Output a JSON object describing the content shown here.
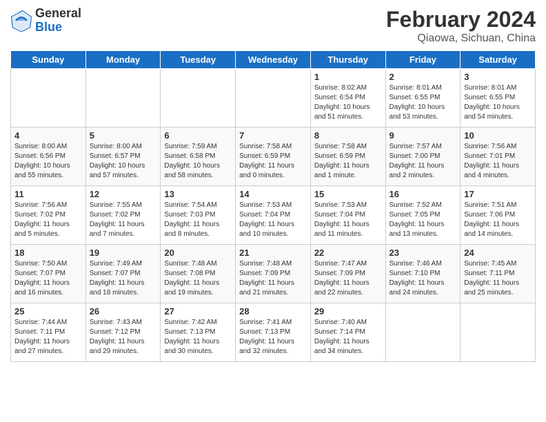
{
  "header": {
    "logo_line1": "General",
    "logo_line2": "Blue",
    "main_title": "February 2024",
    "subtitle": "Qiaowa, Sichuan, China"
  },
  "days_of_week": [
    "Sunday",
    "Monday",
    "Tuesday",
    "Wednesday",
    "Thursday",
    "Friday",
    "Saturday"
  ],
  "weeks": [
    [
      {
        "num": "",
        "content": ""
      },
      {
        "num": "",
        "content": ""
      },
      {
        "num": "",
        "content": ""
      },
      {
        "num": "",
        "content": ""
      },
      {
        "num": "1",
        "content": "Sunrise: 8:02 AM\nSunset: 6:54 PM\nDaylight: 10 hours\nand 51 minutes."
      },
      {
        "num": "2",
        "content": "Sunrise: 8:01 AM\nSunset: 6:55 PM\nDaylight: 10 hours\nand 53 minutes."
      },
      {
        "num": "3",
        "content": "Sunrise: 8:01 AM\nSunset: 6:55 PM\nDaylight: 10 hours\nand 54 minutes."
      }
    ],
    [
      {
        "num": "4",
        "content": "Sunrise: 8:00 AM\nSunset: 6:56 PM\nDaylight: 10 hours\nand 55 minutes."
      },
      {
        "num": "5",
        "content": "Sunrise: 8:00 AM\nSunset: 6:57 PM\nDaylight: 10 hours\nand 57 minutes."
      },
      {
        "num": "6",
        "content": "Sunrise: 7:59 AM\nSunset: 6:58 PM\nDaylight: 10 hours\nand 58 minutes."
      },
      {
        "num": "7",
        "content": "Sunrise: 7:58 AM\nSunset: 6:59 PM\nDaylight: 11 hours\nand 0 minutes."
      },
      {
        "num": "8",
        "content": "Sunrise: 7:58 AM\nSunset: 6:59 PM\nDaylight: 11 hours\nand 1 minute."
      },
      {
        "num": "9",
        "content": "Sunrise: 7:57 AM\nSunset: 7:00 PM\nDaylight: 11 hours\nand 2 minutes."
      },
      {
        "num": "10",
        "content": "Sunrise: 7:56 AM\nSunset: 7:01 PM\nDaylight: 11 hours\nand 4 minutes."
      }
    ],
    [
      {
        "num": "11",
        "content": "Sunrise: 7:56 AM\nSunset: 7:02 PM\nDaylight: 11 hours\nand 5 minutes."
      },
      {
        "num": "12",
        "content": "Sunrise: 7:55 AM\nSunset: 7:02 PM\nDaylight: 11 hours\nand 7 minutes."
      },
      {
        "num": "13",
        "content": "Sunrise: 7:54 AM\nSunset: 7:03 PM\nDaylight: 11 hours\nand 8 minutes."
      },
      {
        "num": "14",
        "content": "Sunrise: 7:53 AM\nSunset: 7:04 PM\nDaylight: 11 hours\nand 10 minutes."
      },
      {
        "num": "15",
        "content": "Sunrise: 7:53 AM\nSunset: 7:04 PM\nDaylight: 11 hours\nand 11 minutes."
      },
      {
        "num": "16",
        "content": "Sunrise: 7:52 AM\nSunset: 7:05 PM\nDaylight: 11 hours\nand 13 minutes."
      },
      {
        "num": "17",
        "content": "Sunrise: 7:51 AM\nSunset: 7:06 PM\nDaylight: 11 hours\nand 14 minutes."
      }
    ],
    [
      {
        "num": "18",
        "content": "Sunrise: 7:50 AM\nSunset: 7:07 PM\nDaylight: 11 hours\nand 16 minutes."
      },
      {
        "num": "19",
        "content": "Sunrise: 7:49 AM\nSunset: 7:07 PM\nDaylight: 11 hours\nand 18 minutes."
      },
      {
        "num": "20",
        "content": "Sunrise: 7:48 AM\nSunset: 7:08 PM\nDaylight: 11 hours\nand 19 minutes."
      },
      {
        "num": "21",
        "content": "Sunrise: 7:48 AM\nSunset: 7:09 PM\nDaylight: 11 hours\nand 21 minutes."
      },
      {
        "num": "22",
        "content": "Sunrise: 7:47 AM\nSunset: 7:09 PM\nDaylight: 11 hours\nand 22 minutes."
      },
      {
        "num": "23",
        "content": "Sunrise: 7:46 AM\nSunset: 7:10 PM\nDaylight: 11 hours\nand 24 minutes."
      },
      {
        "num": "24",
        "content": "Sunrise: 7:45 AM\nSunset: 7:11 PM\nDaylight: 11 hours\nand 25 minutes."
      }
    ],
    [
      {
        "num": "25",
        "content": "Sunrise: 7:44 AM\nSunset: 7:11 PM\nDaylight: 11 hours\nand 27 minutes."
      },
      {
        "num": "26",
        "content": "Sunrise: 7:43 AM\nSunset: 7:12 PM\nDaylight: 11 hours\nand 29 minutes."
      },
      {
        "num": "27",
        "content": "Sunrise: 7:42 AM\nSunset: 7:13 PM\nDaylight: 11 hours\nand 30 minutes."
      },
      {
        "num": "28",
        "content": "Sunrise: 7:41 AM\nSunset: 7:13 PM\nDaylight: 11 hours\nand 32 minutes."
      },
      {
        "num": "29",
        "content": "Sunrise: 7:40 AM\nSunset: 7:14 PM\nDaylight: 11 hours\nand 34 minutes."
      },
      {
        "num": "",
        "content": ""
      },
      {
        "num": "",
        "content": ""
      }
    ]
  ]
}
